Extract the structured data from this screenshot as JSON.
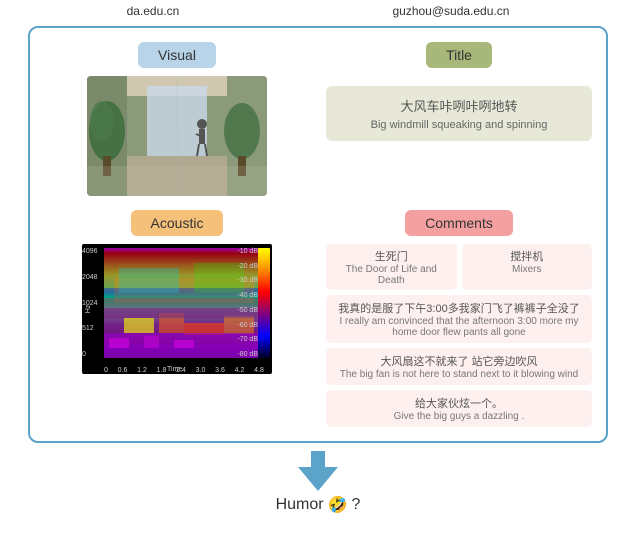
{
  "topbar": {
    "left": "da.edu.cn",
    "right": "guzhou@suda.edu.cn"
  },
  "card": {
    "visual_label": "Visual",
    "title_label": "Title",
    "acoustic_label": "Acoustic",
    "comments_label": "Comments",
    "title_content": {
      "zh": "大风车咔咧咔咧地转",
      "en": "Big windmill squeaking and spinning"
    },
    "comments": [
      {
        "type": "row",
        "items": [
          {
            "zh": "生死门",
            "en": "The Door of Life and Death"
          },
          {
            "zh": "搅拌机",
            "en": "Mixers"
          }
        ]
      },
      {
        "type": "full",
        "zh": "我真的是服了下午3:00多我家门飞了裤裤子全没了",
        "en": "I really am convinced that the afternoon 3:00 more my home door flew pants all gone"
      },
      {
        "type": "full",
        "zh": "大风扇这不就来了 站它旁边吹风",
        "en": "The big fan is not here to stand next to it blowing wind"
      },
      {
        "type": "full",
        "zh": "给大家伙炫一个。",
        "en": "Give the big guys a dazzling ."
      }
    ],
    "spectrogram": {
      "y_labels": [
        "4096",
        "2048",
        "1024",
        "512",
        "0"
      ],
      "x_labels": [
        "0",
        "0.6",
        "1.2",
        "1.8",
        "2.4",
        "3.0",
        "3.6",
        "4.2",
        "4.8"
      ],
      "colorbar_labels": [
        "-10 dB",
        "-20 dB",
        "-30 dB",
        "-40 dB",
        "-50 dB",
        "-60 dB",
        "-70 dB",
        "-80 dB"
      ],
      "hz_label": "Hz",
      "time_label": "Time"
    }
  },
  "humor_label": "Humor",
  "humor_emoji": "🤣"
}
